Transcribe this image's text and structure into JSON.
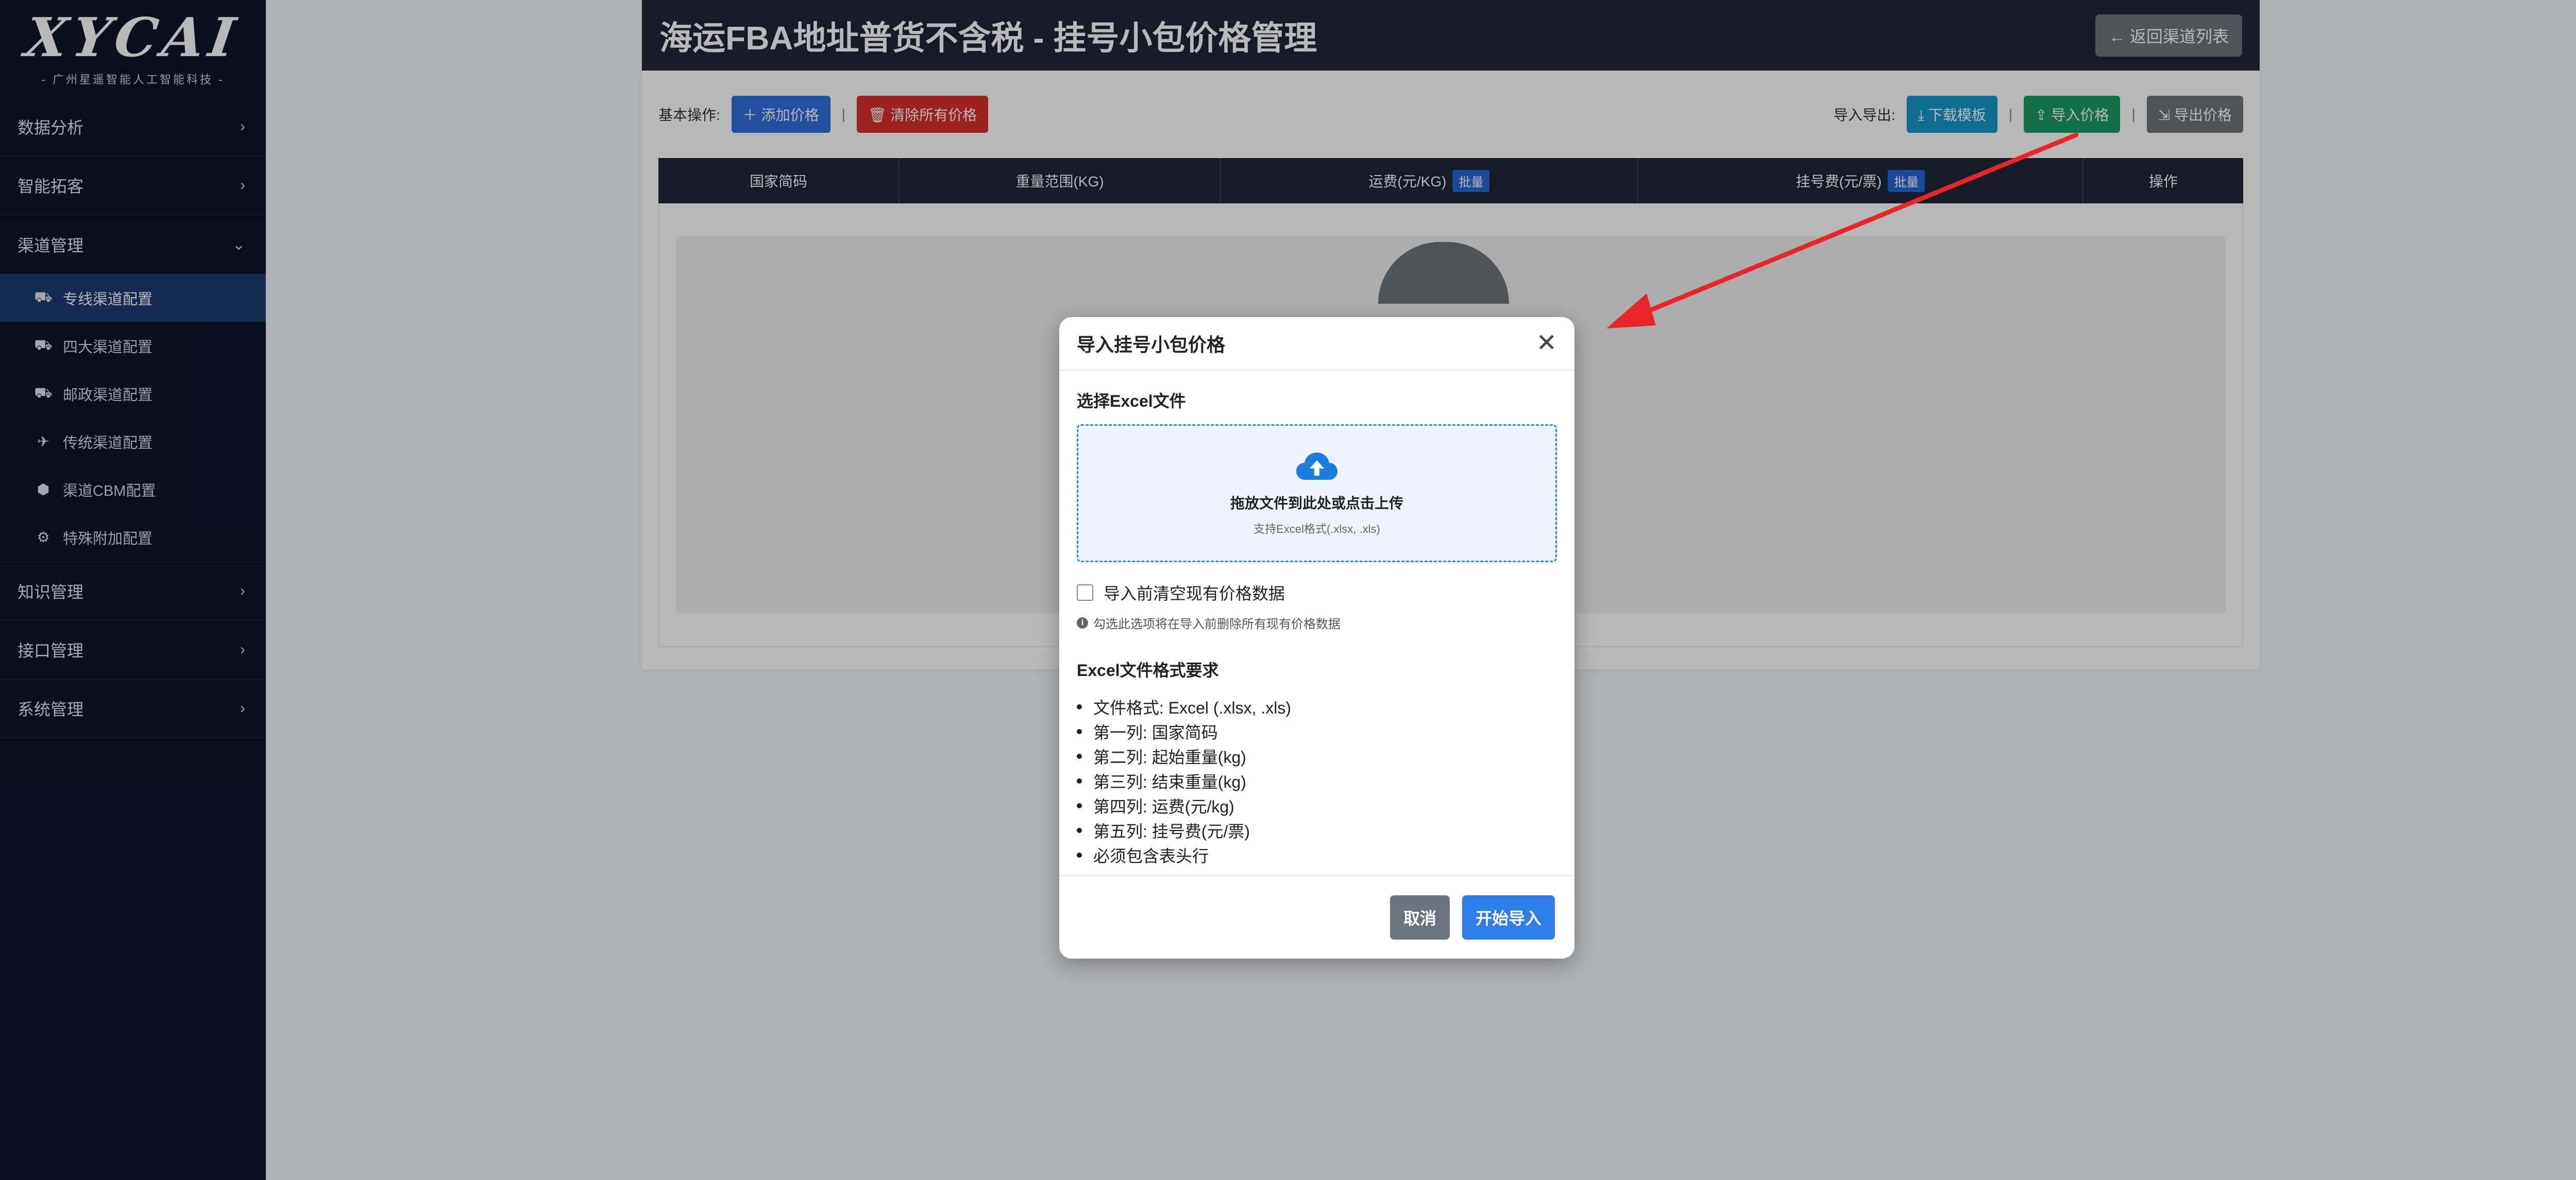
{
  "sidebar": {
    "logo": "XYCAI",
    "logo_sub": "- 广州星遥智能人工智能科技 -",
    "groups": [
      {
        "label": "数据分析"
      },
      {
        "label": "智能拓客"
      },
      {
        "label": "渠道管理"
      },
      {
        "label": "知识管理"
      },
      {
        "label": "接口管理"
      },
      {
        "label": "系统管理"
      }
    ],
    "channel_items": [
      {
        "label": "专线渠道配置",
        "icon": "truck-icon",
        "active": true
      },
      {
        "label": "四大渠道配置",
        "icon": "truck-icon"
      },
      {
        "label": "邮政渠道配置",
        "icon": "truck-icon"
      },
      {
        "label": "传统渠道配置",
        "icon": "plane-icon"
      },
      {
        "label": "渠道CBM配置",
        "icon": "box-icon"
      },
      {
        "label": "特殊附加配置",
        "icon": "gear-icon"
      }
    ]
  },
  "page": {
    "title": "海运FBA地址普货不含税 - 挂号小包价格管理",
    "back_label": "返回渠道列表"
  },
  "toolbar": {
    "basic_label": "基本操作:",
    "add_price": "添加价格",
    "clear_prices": "清除所有价格",
    "io_label": "导入导出:",
    "download_template": "下载模板",
    "import_price": "导入价格",
    "export_price": "导出价格",
    "separator": "|"
  },
  "table": {
    "columns": [
      {
        "label": "国家简码"
      },
      {
        "label": "重量范围(KG)"
      },
      {
        "label": "运费(元/KG)",
        "badge": "批量"
      },
      {
        "label": "挂号费(元/票)",
        "badge": "批量"
      },
      {
        "label": "操作"
      }
    ]
  },
  "modal": {
    "title": "导入挂号小包价格",
    "close": "✕",
    "file_label": "选择Excel文件",
    "drop_text": "拖放文件到此处或点击上传",
    "drop_hint": "支持Excel格式(.xlsx, .xls)",
    "clear_checkbox_label": "导入前清空现有价格数据",
    "clear_hint": "勾选此选项将在导入前删除所有现有价格数据",
    "req_title": "Excel文件格式要求",
    "requirements": [
      "文件格式: Excel (.xlsx, .xls)",
      "第一列: 国家简码",
      "第二列: 起始重量(kg)",
      "第三列: 结束重量(kg)",
      "第四列: 运费(元/kg)",
      "第五列: 挂号费(元/票)",
      "必须包含表头行"
    ],
    "cancel": "取消",
    "start_import": "开始导入"
  },
  "colors": {
    "sidebar_bg": "#0d1529",
    "header_bg": "#1c2637",
    "primary": "#2f7de8",
    "danger": "#d9302c",
    "success": "#199a63",
    "annotation_arrow": "#e8262a"
  }
}
